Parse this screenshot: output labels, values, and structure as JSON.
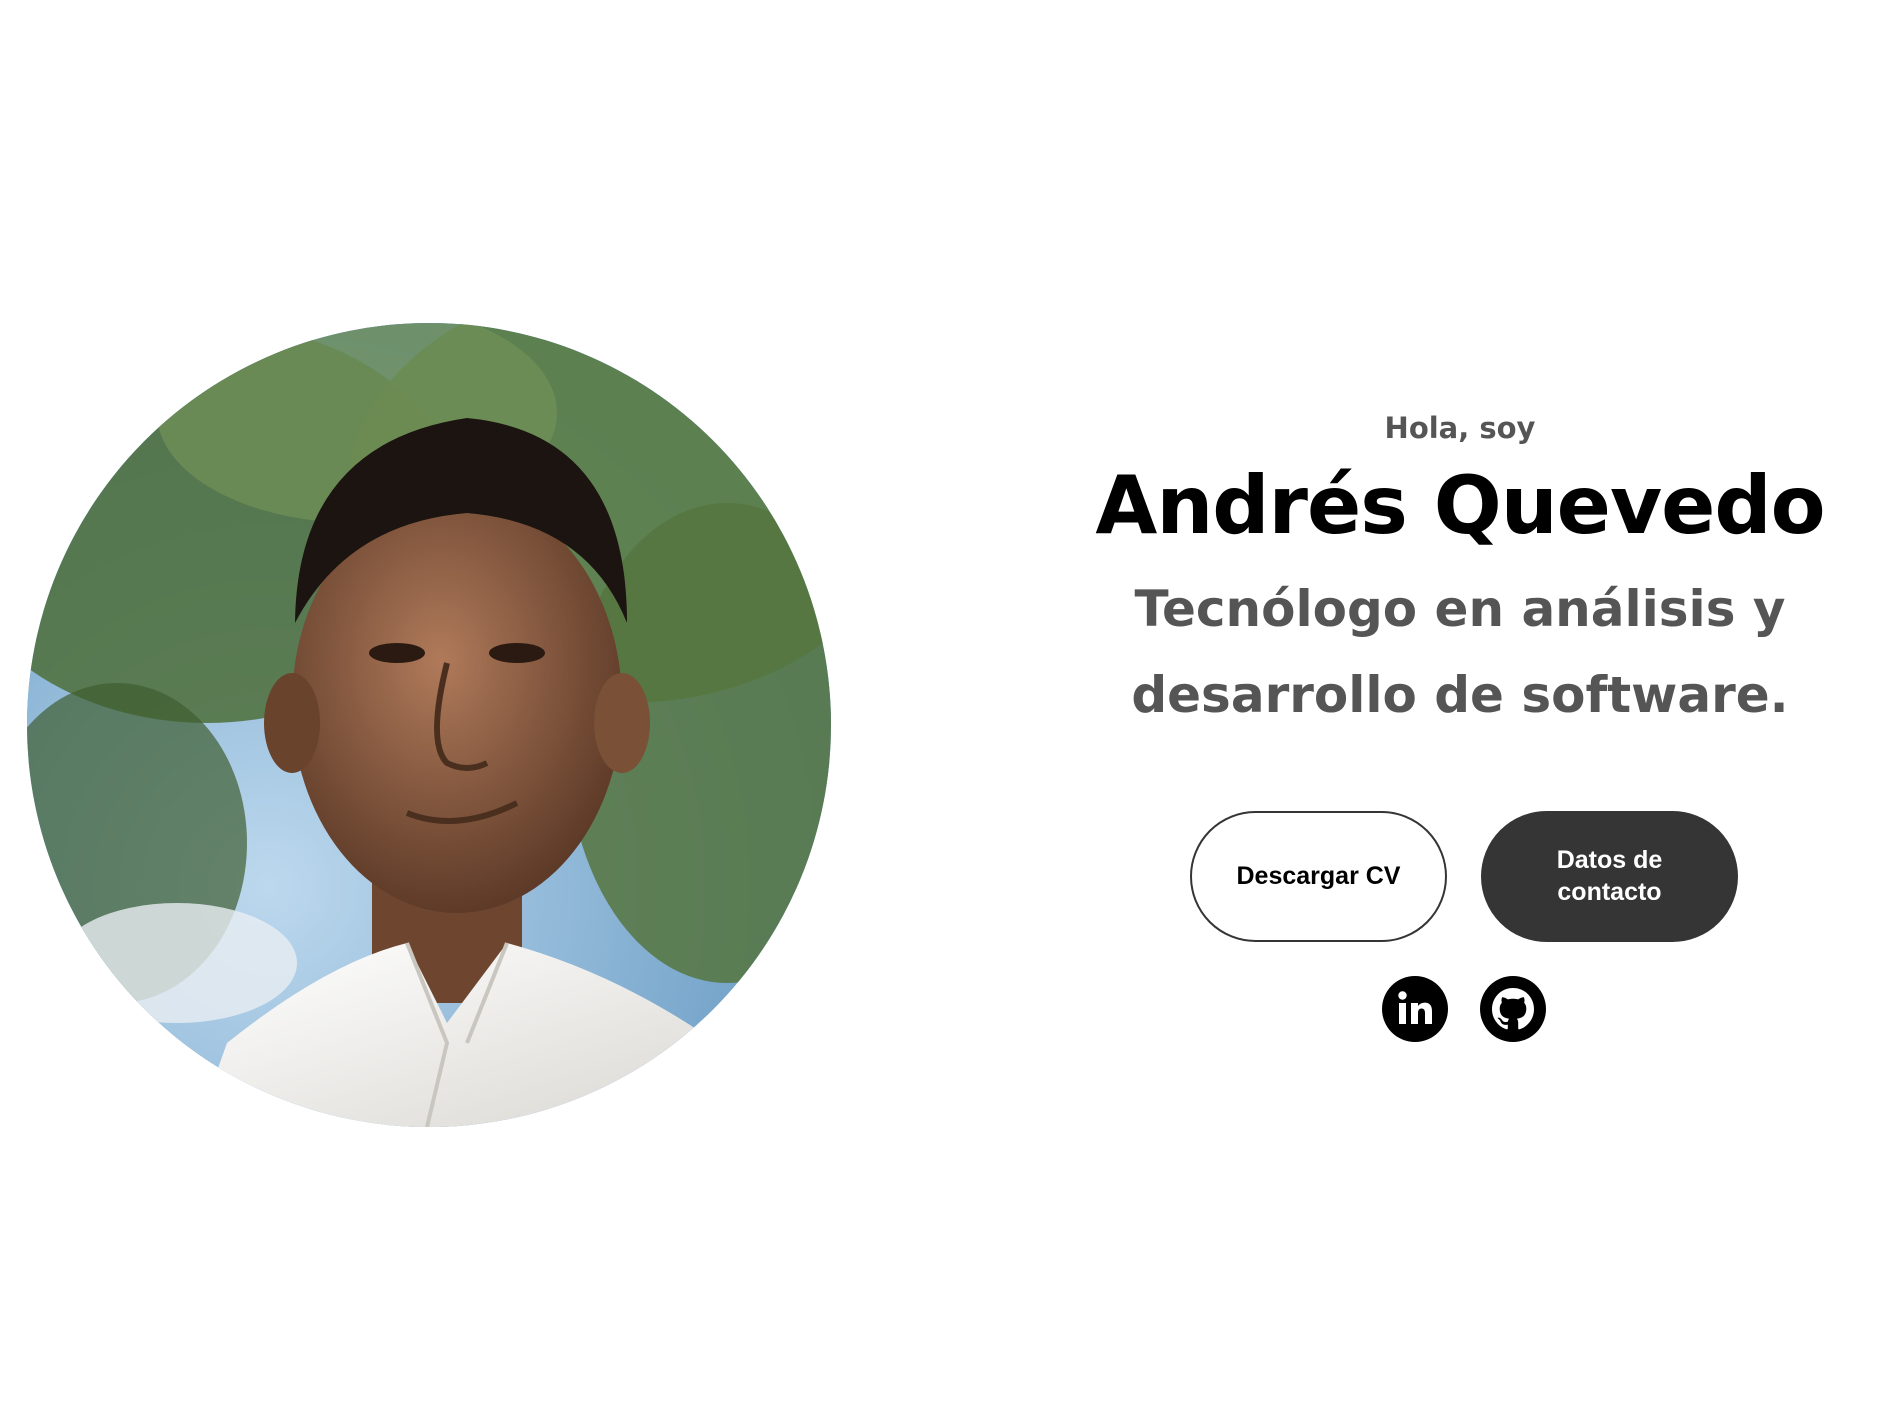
{
  "profile": {
    "photo_icon": "profile-photo"
  },
  "intro": {
    "greeting": "Hola, soy",
    "name": "Andrés Quevedo",
    "role_line1": "Tecnólogo en análisis y",
    "role_line2": "desarrollo de software."
  },
  "buttons": {
    "download_cv": "Descargar CV",
    "contact_line1": "Datos de",
    "contact_line2": "contacto"
  },
  "socials": {
    "linkedin_icon": "linkedin-icon",
    "github_icon": "github-icon"
  },
  "colors": {
    "primary_text": "#000000",
    "secondary_text": "#555555",
    "button_dark": "#353535",
    "background": "#ffffff"
  }
}
